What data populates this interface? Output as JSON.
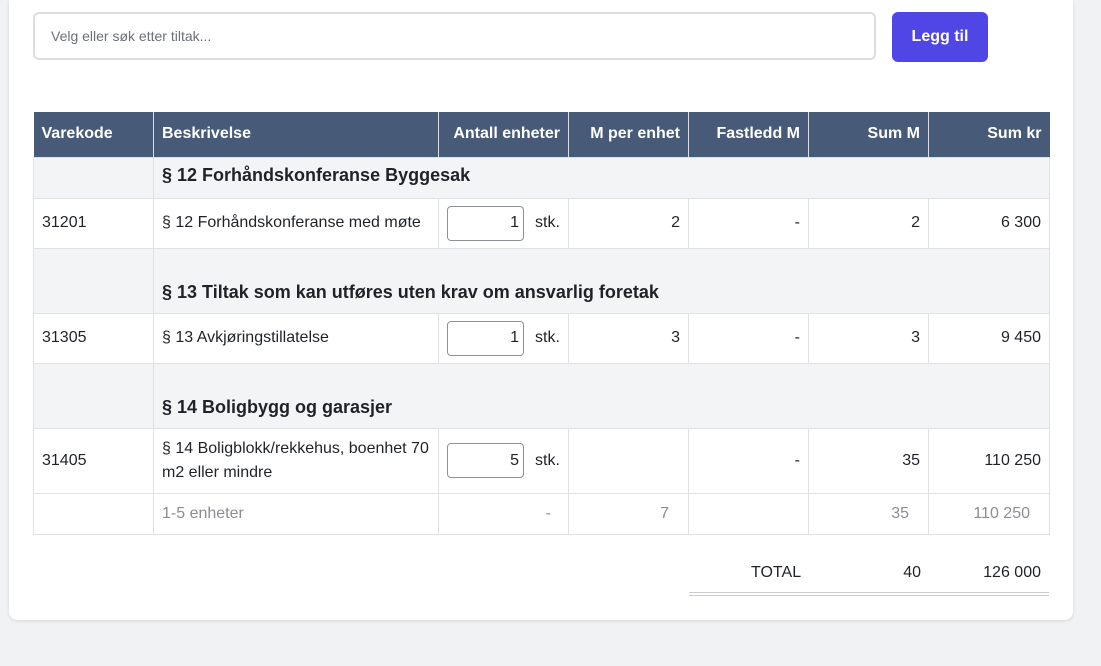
{
  "search": {
    "placeholder": "Velg eller søk etter tiltak..."
  },
  "add_button_label": "Legg til",
  "table": {
    "headers": [
      "Varekode",
      "Beskrivelse",
      "Antall enheter",
      "M per enhet",
      "Fastledd M",
      "Sum M",
      "Sum kr"
    ],
    "unit_label": "stk.",
    "sections": [
      {
        "title": "§ 12 Forhåndskonferanse Byggesak",
        "rows": [
          {
            "code": "31201",
            "description": "§ 12 Forhåndskonferanse med møte",
            "quantity": "1",
            "m_per_unit": "2",
            "fixed_m": "-",
            "sum_m": "2",
            "sum_kr": "6 300"
          }
        ]
      },
      {
        "title": "§ 13 Tiltak som kan utføres uten krav om ansvarlig foretak",
        "rows": [
          {
            "code": "31305",
            "description": "§ 13 Avkjøringstillatelse",
            "quantity": "1",
            "m_per_unit": "3",
            "fixed_m": "-",
            "sum_m": "3",
            "sum_kr": "9 450"
          }
        ]
      },
      {
        "title": "§ 14 Boligbygg og garasjer",
        "rows": [
          {
            "code": "31405",
            "description": "§ 14 Boligblokk/rekkehus, boenhet 70 m2 eller mindre",
            "quantity": "5",
            "m_per_unit": "",
            "fixed_m": "-",
            "sum_m": "35",
            "sum_kr": "110 250"
          }
        ],
        "subrow": {
          "description": "1-5 enheter",
          "quantity": "-",
          "m_per_unit": "7",
          "fixed_m": "",
          "sum_m": "35",
          "sum_kr": "110 250"
        }
      }
    ]
  },
  "total": {
    "label": "TOTAL",
    "sum_m": "40",
    "sum_kr": "126 000"
  }
}
